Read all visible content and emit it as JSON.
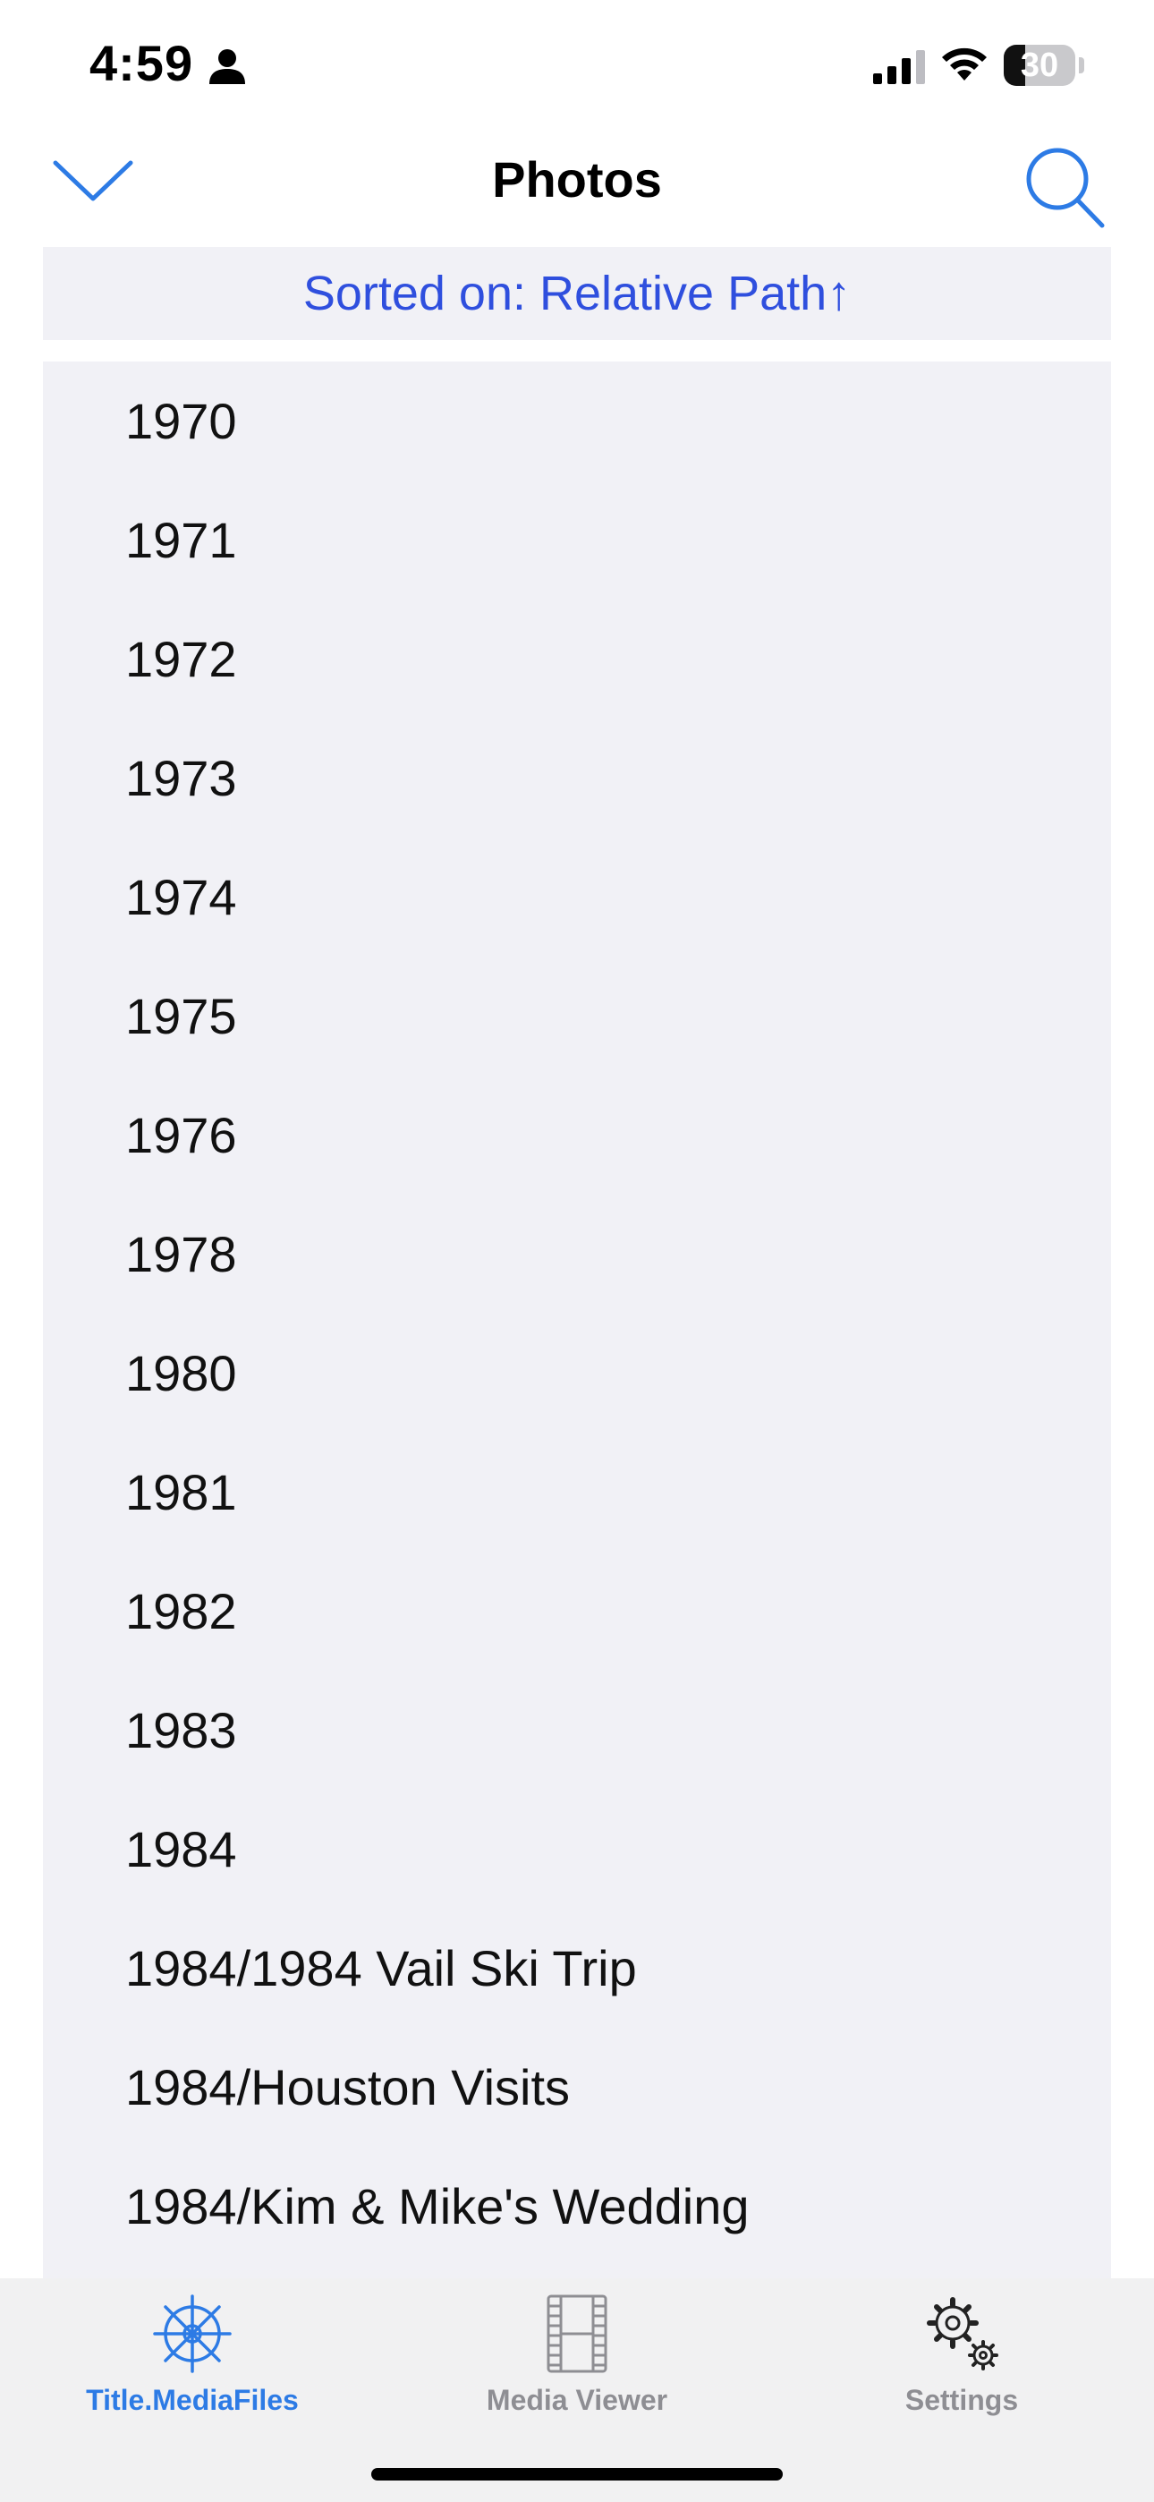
{
  "status_bar": {
    "time": "4:59",
    "battery_level": "30",
    "battery_fraction": 0.3
  },
  "nav": {
    "title": "Photos"
  },
  "sort_banner": {
    "text": "Sorted on: Relative Path↑"
  },
  "list": {
    "items": [
      {
        "label": "1970"
      },
      {
        "label": "1971"
      },
      {
        "label": "1972"
      },
      {
        "label": "1973"
      },
      {
        "label": "1974"
      },
      {
        "label": "1975"
      },
      {
        "label": "1976"
      },
      {
        "label": "1978"
      },
      {
        "label": "1980"
      },
      {
        "label": "1981"
      },
      {
        "label": "1982"
      },
      {
        "label": "1983"
      },
      {
        "label": "1984"
      },
      {
        "label": "1984/1984 Vail Ski Trip"
      },
      {
        "label": "1984/Houston Visits"
      },
      {
        "label": "1984/Kim & Mike's Wedding"
      }
    ]
  },
  "tab_bar": {
    "tabs": [
      {
        "label": "Title.MediaFiles",
        "icon": "ship-wheel-icon",
        "active": true
      },
      {
        "label": "Media Viewer",
        "icon": "film-strip-icon",
        "active": false
      },
      {
        "label": "Settings",
        "icon": "gears-icon",
        "active": false
      }
    ]
  },
  "colors": {
    "accent": "#2d7be5",
    "sort_text": "#2f4fde",
    "list_background": "#f1f1f6",
    "inactive_tab": "#8e8e93"
  }
}
